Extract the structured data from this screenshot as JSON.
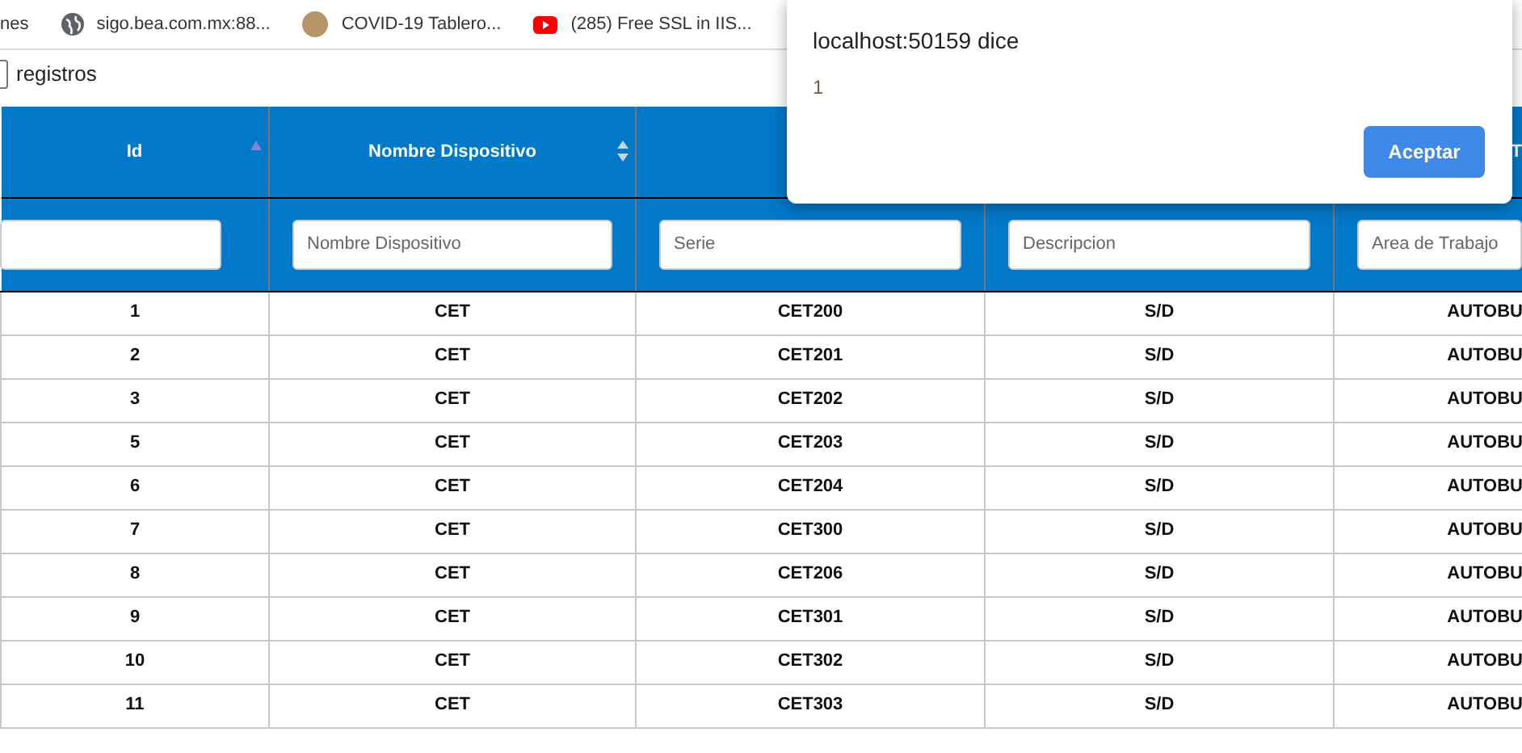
{
  "bookmarks": [
    {
      "label": "nes",
      "kind": "none"
    },
    {
      "label": "sigo.bea.com.mx:88...",
      "kind": "globe"
    },
    {
      "label": "COVID-19 Tablero...",
      "kind": "dot"
    },
    {
      "label": "(285) Free SSL in IIS...",
      "kind": "video"
    }
  ],
  "length_label": "registros",
  "table": {
    "columns": [
      {
        "label": "Id",
        "sorted": true
      },
      {
        "label": "Nombre Dispositivo",
        "sorted": false,
        "placeholder": "Nombre Dispositivo"
      },
      {
        "placeholder": "Serie"
      },
      {
        "placeholder": "Descripcion"
      },
      {
        "label": "T",
        "placeholder": "Area de Trabajo"
      }
    ],
    "rows": [
      [
        "1",
        "CET",
        "CET200",
        "S/D",
        "AUTOBU"
      ],
      [
        "2",
        "CET",
        "CET201",
        "S/D",
        "AUTOBU"
      ],
      [
        "3",
        "CET",
        "CET202",
        "S/D",
        "AUTOBU"
      ],
      [
        "5",
        "CET",
        "CET203",
        "S/D",
        "AUTOBU"
      ],
      [
        "6",
        "CET",
        "CET204",
        "S/D",
        "AUTOBU"
      ],
      [
        "7",
        "CET",
        "CET300",
        "S/D",
        "AUTOBU"
      ],
      [
        "8",
        "CET",
        "CET206",
        "S/D",
        "AUTOBU"
      ],
      [
        "9",
        "CET",
        "CET301",
        "S/D",
        "AUTOBU"
      ],
      [
        "10",
        "CET",
        "CET302",
        "S/D",
        "AUTOBU"
      ],
      [
        "11",
        "CET",
        "CET303",
        "S/D",
        "AUTOBU"
      ]
    ]
  },
  "dialog": {
    "title": "localhost:50159 dice",
    "message": "1",
    "button": "Aceptar"
  }
}
